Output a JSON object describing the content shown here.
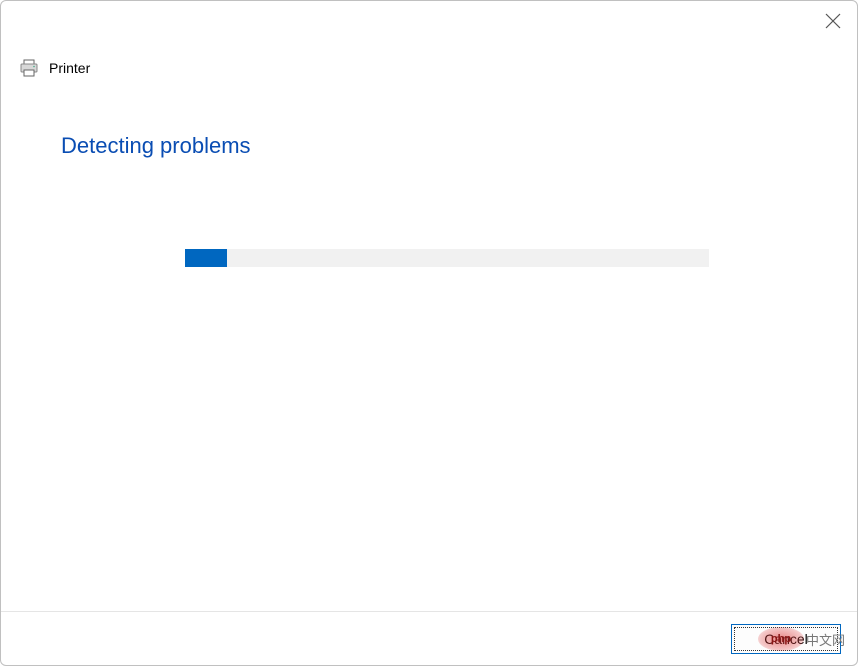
{
  "window": {
    "title": "Printer"
  },
  "content": {
    "heading": "Detecting problems",
    "progress_percent": 8
  },
  "footer": {
    "cancel_label": "Cancel"
  },
  "watermark": {
    "logo_text": "php",
    "suffix": "中文网"
  }
}
